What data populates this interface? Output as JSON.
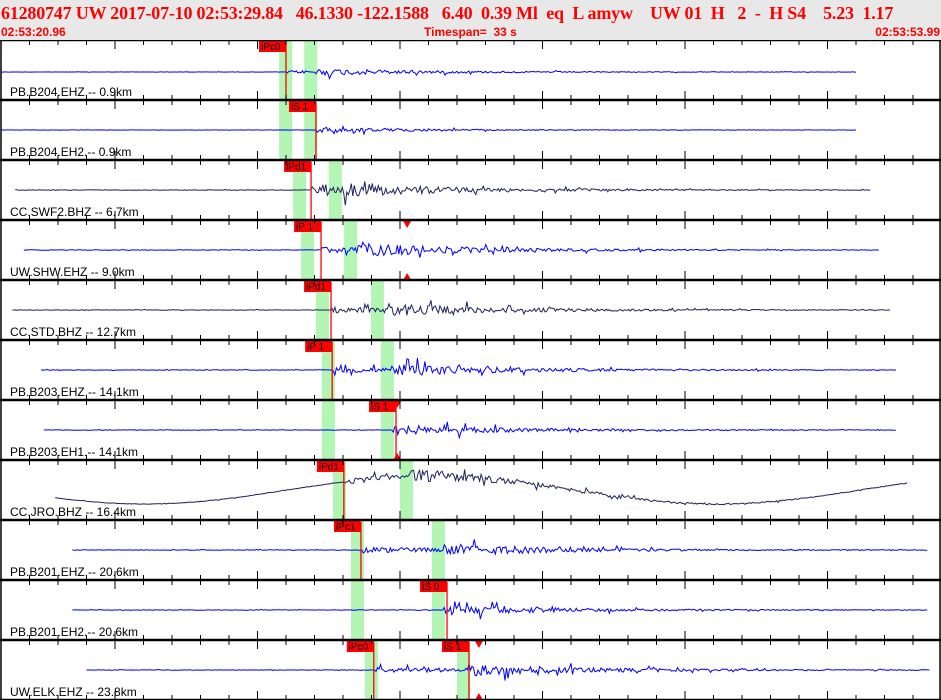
{
  "header": {
    "title": "61280747 UW 2017-07-10 02:53:29.84   46.1330 -122.1588   6.40  0.39 Ml  eq  L amyw    UW 01  H   2  -  H S4    5.23  1.17",
    "start_time": "02:53:20.96",
    "timespan": "Timespan=  33 s",
    "end_time": "02:53:53.99"
  },
  "colors": {
    "header_text": "#ff0000",
    "trace_blue": "#0000ff",
    "trace_navy": "#20205e",
    "pick": "#ff0000",
    "window": "#b3f5b3"
  },
  "panels": [
    {
      "label": "PB.B204.EHZ.-- 0.9km",
      "color": "blue",
      "picks": [
        {
          "text": "iPc0",
          "time": 10.0
        }
      ],
      "windows": [
        9.76,
        10.64
      ],
      "extent": [
        0,
        30
      ],
      "triangles": null
    },
    {
      "label": "PB.B204.EH2.-- 0.9km",
      "color": "blue",
      "picks": [
        {
          "text": "iS 1",
          "time": 11.05
        }
      ],
      "windows": [
        9.76,
        10.64
      ],
      "extent": [
        0,
        30
      ],
      "triangles": null
    },
    {
      "label": "CC.SWF2.BHZ -- 6.7km",
      "color": "navy",
      "picks": [
        {
          "text": "iPd1",
          "time": 10.88
        }
      ],
      "windows": [
        10.25,
        11.5
      ],
      "extent": [
        0.5,
        30.5
      ],
      "triangles": null
    },
    {
      "label": "UW.SHW.EHZ -- 9.0km",
      "color": "blue",
      "picks": [
        {
          "text": "iP 1",
          "time": 11.23
        }
      ],
      "windows": [
        10.53,
        12.04
      ],
      "extent": [
        0.8,
        30.8
      ],
      "triangles": 14.25
    },
    {
      "label": "CC.STD.BHZ -- 12.7km",
      "color": "navy",
      "picks": [
        {
          "text": "iPd1",
          "time": 11.58
        }
      ],
      "windows": [
        11.05,
        12.98
      ],
      "extent": [
        0.4,
        31.2
      ],
      "triangles": null
    },
    {
      "label": "PB.B203.EHZ.-- 14.1km",
      "color": "blue",
      "picks": [
        {
          "text": "iP 1",
          "time": 11.62
        }
      ],
      "windows": [
        11.26,
        13.33
      ],
      "extent": [
        1.4,
        31.4
      ],
      "triangles": null
    },
    {
      "label": "PB.B203.EH1.-- 14.1km",
      "color": "blue",
      "picks": [
        {
          "text": "iS 1",
          "time": 13.86
        }
      ],
      "windows": [
        11.26,
        13.33
      ],
      "extent": [
        1.5,
        31.4
      ],
      "triangles": 13.9
    },
    {
      "label": "CC.JRO.BHZ -- 16.4km",
      "color": "navy",
      "picks": [
        {
          "text": "iPd1",
          "time": 12.03
        }
      ],
      "windows": [
        11.65,
        14.0
      ],
      "extent": [
        1.9,
        31.8
      ],
      "triangles": null
    },
    {
      "label": "PB.B201.EHZ.-- 20.6km",
      "color": "blue",
      "picks": [
        {
          "text": "iPc1",
          "time": 12.63
        }
      ],
      "windows": [
        12.28,
        15.12
      ],
      "extent": [
        2.5,
        32.5
      ],
      "triangles": null
    },
    {
      "label": "PB.B201.EH2.-- 20.6km",
      "color": "blue",
      "picks": [
        {
          "text": "iS 0",
          "time": 15.65
        }
      ],
      "windows": [
        12.28,
        15.12
      ],
      "extent": [
        2.5,
        32.5
      ],
      "triangles": null
    },
    {
      "label": "UW.ELK.EHZ -- 23.8km",
      "color": "blue",
      "picks": [
        {
          "text": "iPc0",
          "time": 13.08
        },
        {
          "text": "iS 1",
          "time": 16.42
        }
      ],
      "windows": [
        12.77,
        16.0
      ],
      "extent": [
        3.0,
        32.6
      ],
      "triangles": 16.77
    }
  ]
}
